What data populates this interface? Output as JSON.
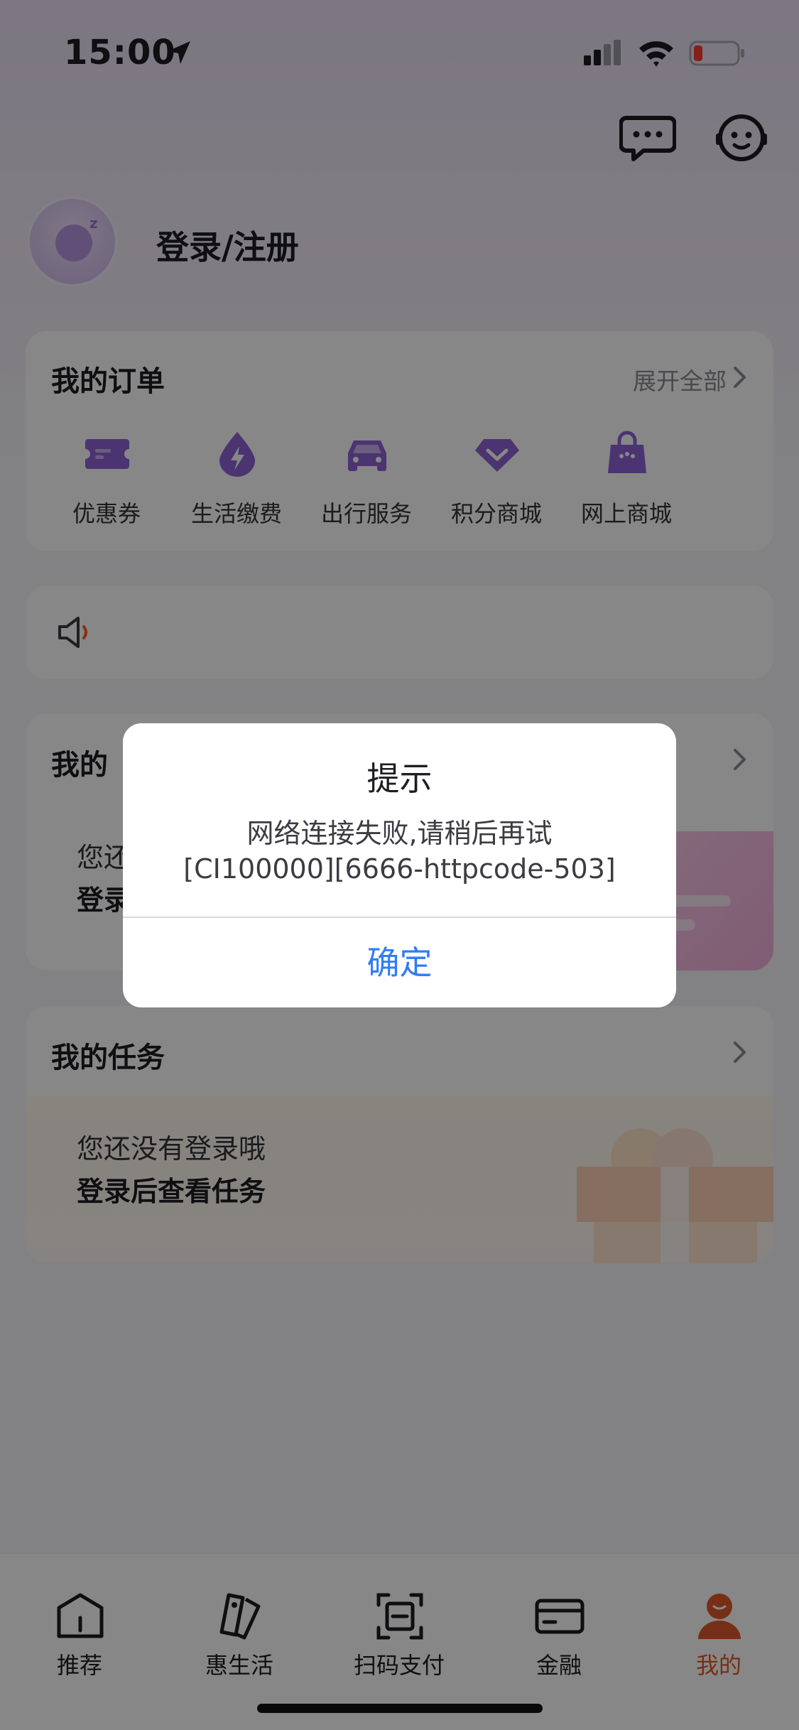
{
  "status_bar": {
    "time": "15:00"
  },
  "profile": {
    "login_label": "登录/注册"
  },
  "orders": {
    "title": "我的订单",
    "expand_label": "展开全部",
    "items": [
      {
        "label": "优惠券",
        "icon": "ticket-icon"
      },
      {
        "label": "生活缴费",
        "icon": "lightning-drop-icon"
      },
      {
        "label": "出行服务",
        "icon": "car-icon"
      },
      {
        "label": "积分商城",
        "icon": "diamond-icon"
      },
      {
        "label": "网上商城",
        "icon": "shopping-bag-icon"
      }
    ]
  },
  "benefits": {
    "title": "我的",
    "line1": "您还",
    "line2": "登录"
  },
  "tasks": {
    "title": "我的任务",
    "line1": "您还没有登录哦",
    "line2": "登录后查看任务"
  },
  "tab_bar": {
    "items": [
      {
        "label": "推荐",
        "icon": "home-icon"
      },
      {
        "label": "惠生活",
        "icon": "tags-icon"
      },
      {
        "label": "扫码支付",
        "icon": "scan-icon"
      },
      {
        "label": "金融",
        "icon": "card-icon"
      },
      {
        "label": "我的",
        "icon": "profile-icon"
      }
    ],
    "active": "我的",
    "active_color": "#e0582a"
  },
  "dialog": {
    "title": "提示",
    "message_line1": "网络连接失败,请稍后再试",
    "message_line2": "[CI100000][6666-httpcode-503]",
    "confirm_label": "确定",
    "confirm_color": "#2f7df6"
  },
  "colors": {
    "accent_purple": "#8f63d6",
    "battery_low": "#ff3b30"
  }
}
